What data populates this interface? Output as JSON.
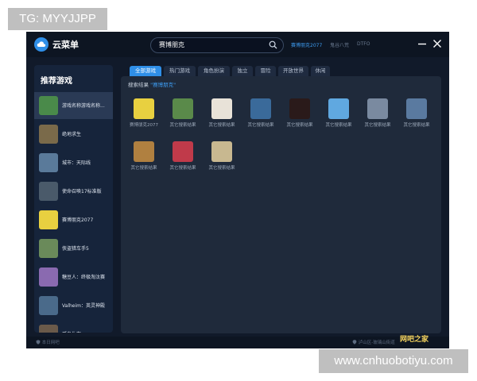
{
  "watermarks": {
    "top": "TG: MYYJJPP",
    "bottom": "www.cnhuobotiyu.com"
  },
  "colors": {
    "accent": "#2f8fe8",
    "background": "#111a2a",
    "sidebar": "#16243b",
    "panel": "#1f2a3b"
  },
  "titlebar": {
    "app_name": "云菜单",
    "search_value": "赛博朋克",
    "hot_searches": [
      "赛博朋克2077",
      "鬼谷八荒",
      "DTFO"
    ],
    "minimize_icon": "minimize-icon",
    "close_icon": "close-icon"
  },
  "sidebar": {
    "title": "推荐游戏",
    "items": [
      {
        "label": "游戏名称游戏名称...",
        "color": "#4a8a4a"
      },
      {
        "label": "绝地求生",
        "color": "#7a6a4a"
      },
      {
        "label": "城市：天际线",
        "color": "#5a7a9a"
      },
      {
        "label": "使命召唤17标准版",
        "color": "#4a5a6a"
      },
      {
        "label": "赛博朋克2077",
        "color": "#e8d040"
      },
      {
        "label": "侠盗猎车手5",
        "color": "#6a8a5a"
      },
      {
        "label": "糖豆人：终极淘汰赛",
        "color": "#8a6ab0"
      },
      {
        "label": "Valheim：英灵神殿",
        "color": "#4a6a8a"
      },
      {
        "label": "孤岛生存...",
        "color": "#6a5a4a"
      }
    ]
  },
  "tabs": [
    "全部游戏",
    "热门游戏",
    "角色扮演",
    "独立",
    "冒险",
    "开放世界",
    "休闲"
  ],
  "results": {
    "label_prefix": "搜索结果",
    "query": "\"赛博朋克\"",
    "items": [
      {
        "label": "赛博朋克2077",
        "color": "#e8d040"
      },
      {
        "label": "其它搜索结果",
        "color": "#5a8a4a"
      },
      {
        "label": "其它搜索结果",
        "color": "#e8e2d8"
      },
      {
        "label": "其它搜索结果",
        "color": "#3a6a9a"
      },
      {
        "label": "其它搜索结果",
        "color": "#2a1a1a"
      },
      {
        "label": "其它搜索结果",
        "color": "#60a8e0"
      },
      {
        "label": "其它搜索结果",
        "color": "#7a8aa0"
      },
      {
        "label": "其它搜索结果",
        "color": "#5a7aa0"
      },
      {
        "label": "其它搜索结果",
        "color": "#b08040"
      },
      {
        "label": "其它搜索结果",
        "color": "#c03a4a"
      },
      {
        "label": "其它搜索结果",
        "color": "#c8b890"
      }
    ]
  },
  "status": {
    "left": "本日网吧",
    "right": "泸山区-玻璃山街道"
  },
  "corner_logo": "网吧之家"
}
